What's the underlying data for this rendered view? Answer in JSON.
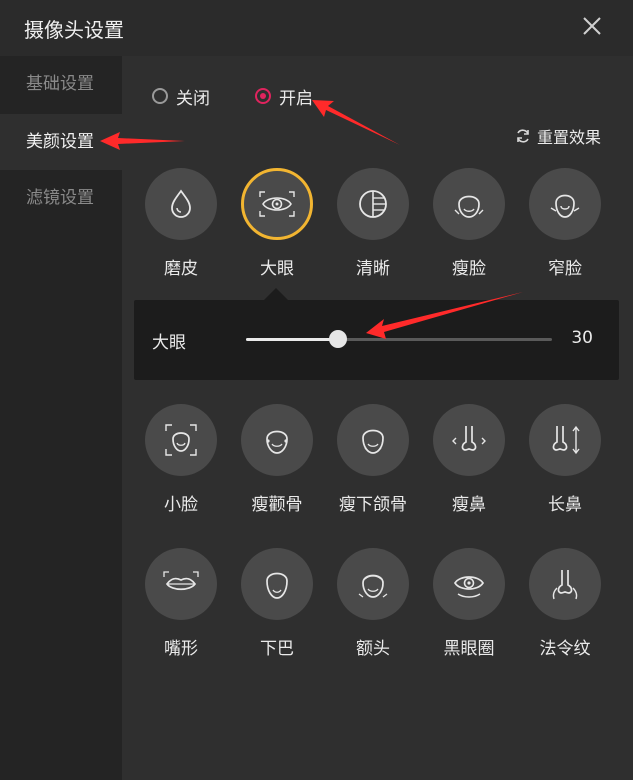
{
  "window": {
    "title": "摄像头设置"
  },
  "sidebar": {
    "items": [
      {
        "label": "基础设置"
      },
      {
        "label": "美颜设置"
      },
      {
        "label": "滤镜设置"
      }
    ]
  },
  "toggle": {
    "off_label": "关闭",
    "on_label": "开启",
    "selected": "开启"
  },
  "reset_label": "重置效果",
  "row1": [
    {
      "label": "磨皮",
      "icon": "drop-icon"
    },
    {
      "label": "大眼",
      "icon": "eye-focus-icon"
    },
    {
      "label": "清晰",
      "icon": "clarity-icon"
    },
    {
      "label": "瘦脸",
      "icon": "slim-face-icon"
    },
    {
      "label": "窄脸",
      "icon": "narrow-face-icon"
    }
  ],
  "slider": {
    "label": "大眼",
    "value": "30",
    "fraction": 0.3
  },
  "row2": [
    {
      "label": "小脸",
      "icon": "small-face-icon"
    },
    {
      "label": "瘦颧骨",
      "icon": "cheekbone-icon"
    },
    {
      "label": "瘦下颌骨",
      "icon": "jaw-icon"
    },
    {
      "label": "瘦鼻",
      "icon": "nose-icon"
    },
    {
      "label": "长鼻",
      "icon": "long-nose-icon"
    }
  ],
  "row3": [
    {
      "label": "嘴形",
      "icon": "mouth-icon"
    },
    {
      "label": "下巴",
      "icon": "chin-icon"
    },
    {
      "label": "额头",
      "icon": "forehead-icon"
    },
    {
      "label": "黑眼圈",
      "icon": "eye-circle-icon"
    },
    {
      "label": "法令纹",
      "icon": "nasolabial-icon"
    }
  ],
  "colors": {
    "accent": "#e0245e",
    "selected_ring": "#f2b531",
    "annotation": "#ff2a2a"
  }
}
